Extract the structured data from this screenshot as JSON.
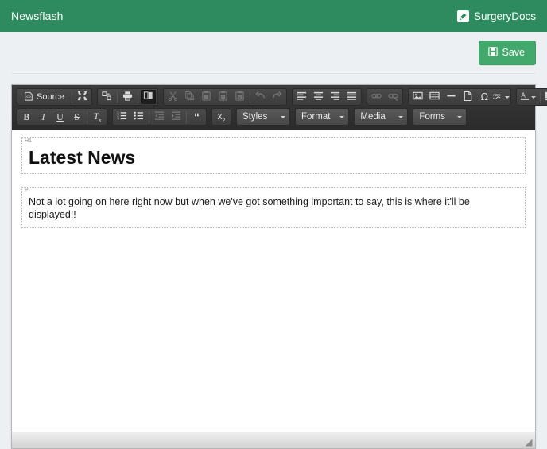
{
  "navbar": {
    "brand": "Newsflash",
    "app_name": "SurgeryDocs",
    "app_icon": "pencil-square-icon",
    "bg_color": "#2e8b5f"
  },
  "actions": {
    "save_label": "Save",
    "save_icon": "floppy-disk-icon",
    "save_color": "#43a86c"
  },
  "editor": {
    "toolbar_rows": [
      {
        "groups": [
          {
            "name": "document",
            "items": [
              {
                "name": "source-button",
                "label": "Source",
                "icon": "source-code-icon",
                "type": "text",
                "state": "normal"
              },
              {
                "name": "maximize-button",
                "label": "",
                "icon": "maximize-icon",
                "type": "icon",
                "state": "normal"
              }
            ]
          },
          {
            "name": "tools",
            "items": [
              {
                "name": "templates-button",
                "label": "",
                "icon": "templates-icon",
                "type": "icon",
                "state": "normal"
              },
              {
                "name": "print-button",
                "label": "",
                "icon": "print-icon",
                "type": "icon",
                "state": "normal"
              },
              {
                "name": "show-blocks-button",
                "label": "",
                "icon": "show-blocks-icon",
                "type": "icon",
                "state": "active"
              }
            ]
          },
          {
            "name": "clipboard",
            "items": [
              {
                "name": "cut-button",
                "label": "",
                "icon": "scissors-icon",
                "type": "icon",
                "state": "disabled"
              },
              {
                "name": "copy-button",
                "label": "",
                "icon": "copy-icon",
                "type": "icon",
                "state": "disabled"
              },
              {
                "name": "paste-button",
                "label": "",
                "icon": "paste-icon",
                "type": "icon",
                "state": "disabled"
              },
              {
                "name": "paste-text-button",
                "label": "",
                "icon": "paste-text-icon",
                "type": "icon",
                "state": "disabled"
              },
              {
                "name": "paste-word-button",
                "label": "",
                "icon": "paste-word-icon",
                "type": "icon",
                "state": "disabled"
              },
              {
                "name": "undo-button",
                "label": "",
                "icon": "undo-arrow-icon",
                "type": "icon",
                "state": "disabled"
              },
              {
                "name": "redo-button",
                "label": "",
                "icon": "redo-arrow-icon",
                "type": "icon",
                "state": "disabled"
              }
            ]
          },
          {
            "name": "alignment",
            "items": [
              {
                "name": "align-left-button",
                "label": "",
                "icon": "align-left-icon",
                "type": "icon",
                "state": "normal"
              },
              {
                "name": "align-center-button",
                "label": "",
                "icon": "align-center-icon",
                "type": "icon",
                "state": "normal"
              },
              {
                "name": "align-right-button",
                "label": "",
                "icon": "align-right-icon",
                "type": "icon",
                "state": "normal"
              },
              {
                "name": "align-justify-button",
                "label": "",
                "icon": "align-justify-icon",
                "type": "icon",
                "state": "normal"
              }
            ]
          },
          {
            "name": "links",
            "items": [
              {
                "name": "link-button",
                "label": "",
                "icon": "link-icon",
                "type": "icon",
                "state": "disabled"
              },
              {
                "name": "unlink-button",
                "label": "",
                "icon": "unlink-icon",
                "type": "icon",
                "state": "disabled"
              }
            ]
          },
          {
            "name": "insert",
            "items": [
              {
                "name": "image-button",
                "label": "",
                "icon": "image-icon",
                "type": "icon",
                "state": "normal"
              },
              {
                "name": "table-button",
                "label": "",
                "icon": "table-icon",
                "type": "icon",
                "state": "normal"
              },
              {
                "name": "horizontal-rule-button",
                "label": "",
                "icon": "horizontal-rule-icon",
                "type": "icon",
                "state": "normal"
              },
              {
                "name": "page-break-button",
                "label": "",
                "icon": "page-break-icon",
                "type": "icon",
                "state": "normal"
              },
              {
                "name": "special-char-button",
                "label": "",
                "icon": "omega-icon",
                "type": "icon",
                "state": "normal"
              },
              {
                "name": "spellcheck-button",
                "label": "",
                "icon": "spellcheck-abc-icon",
                "type": "menu",
                "state": "normal"
              }
            ]
          },
          {
            "name": "colors",
            "items": [
              {
                "name": "text-color-button",
                "label": "",
                "icon": "text-color-icon",
                "type": "menu",
                "state": "normal"
              },
              {
                "name": "background-color-button",
                "label": "",
                "icon": "background-color-icon",
                "type": "menu",
                "state": "normal"
              }
            ]
          }
        ]
      },
      {
        "groups": [
          {
            "name": "basic-styles",
            "items": [
              {
                "name": "bold-button",
                "label": "B",
                "icon": "bold-icon",
                "type": "glyph",
                "state": "normal"
              },
              {
                "name": "italic-button",
                "label": "I",
                "icon": "italic-icon",
                "type": "glyph",
                "state": "normal"
              },
              {
                "name": "underline-button",
                "label": "U",
                "icon": "underline-icon",
                "type": "glyph",
                "state": "normal"
              },
              {
                "name": "strikethrough-button",
                "label": "S",
                "icon": "strikethrough-icon",
                "type": "glyph",
                "state": "normal"
              },
              {
                "name": "remove-format-button",
                "label": "T",
                "icon": "remove-format-icon",
                "type": "glyph",
                "state": "normal"
              }
            ]
          },
          {
            "name": "paragraph",
            "items": [
              {
                "name": "numbered-list-button",
                "label": "",
                "icon": "numbered-list-icon",
                "type": "icon",
                "state": "normal"
              },
              {
                "name": "bulleted-list-button",
                "label": "",
                "icon": "bulleted-list-icon",
                "type": "icon",
                "state": "normal"
              },
              {
                "name": "outdent-button",
                "label": "",
                "icon": "outdent-icon",
                "type": "icon",
                "state": "disabled"
              },
              {
                "name": "indent-button",
                "label": "",
                "icon": "indent-icon",
                "type": "icon",
                "state": "disabled"
              },
              {
                "name": "blockquote-button",
                "label": "",
                "icon": "blockquote-icon",
                "type": "icon",
                "state": "normal"
              }
            ]
          },
          {
            "name": "subscript",
            "items": [
              {
                "name": "subscript-button",
                "label": "x",
                "icon": "subscript-icon",
                "type": "glyph",
                "state": "normal"
              }
            ]
          }
        ],
        "combos": [
          {
            "name": "styles-dropdown",
            "label": "Styles"
          },
          {
            "name": "format-dropdown",
            "label": "Format"
          },
          {
            "name": "media-dropdown",
            "label": "Media"
          },
          {
            "name": "forms-dropdown",
            "label": "Forms"
          }
        ]
      }
    ],
    "blocks": [
      {
        "tag": "H1",
        "type": "h1",
        "text": "Latest News"
      },
      {
        "tag": "P",
        "type": "p",
        "text": "Not a lot going on here right now but when we've got something important to say, this is where it'll be displayed!!"
      }
    ],
    "resize_handle": "resize-handle-icon"
  }
}
